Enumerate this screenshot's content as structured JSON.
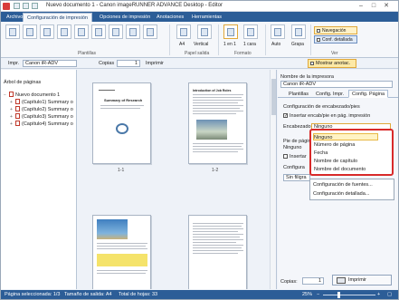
{
  "window": {
    "title": "Nuevo documento 1 - Canon imageRUNNER ADVANCE Desktop - Editor",
    "min_glyph": "–",
    "max_glyph": "□",
    "close_glyph": "✕"
  },
  "ribbon_tabs": [
    "Archivo",
    "Configuración de impresión",
    "Opciones de impresión",
    "Anotaciones",
    "Herramientas"
  ],
  "ribbon": {
    "groups": [
      "Plantillas",
      "Papel salida",
      "Formato",
      "Ver"
    ],
    "size_label": "A4",
    "orientation_label": "Vertical",
    "nup_label": "1 en 1",
    "copies_num": "1",
    "sides_label": "1 cara",
    "color_label": "Auto",
    "staple_label": "Grapa",
    "navigation": "Navegación",
    "detail": "Conf. detallada"
  },
  "toolbar": {
    "printer_label": "Impr.",
    "printer_value": "Canon iR-ADV",
    "copies_label": "Copias",
    "copies_value": "1",
    "print_label": "Imprimir",
    "show_notes": "Mostrar anotac."
  },
  "left_panel": {
    "title": "Árbol de páginas",
    "items": [
      {
        "label": "Nuevo documento 1",
        "expander": "−"
      },
      {
        "label": "(Capítulo1) Summary o",
        "expander": "+"
      },
      {
        "label": "(Capítulo2) Summary o",
        "expander": "+"
      },
      {
        "label": "(Capítulo3) Summary o",
        "expander": "+"
      },
      {
        "label": "(Capítulo4) Summary o",
        "expander": "+"
      }
    ]
  },
  "pages": [
    {
      "label": "1-1",
      "heading": "Summary of Research"
    },
    {
      "label": "1-2",
      "heading": "Introduction of Job Roles"
    },
    {
      "label": "",
      "heading": ""
    },
    {
      "label": "",
      "heading": ""
    }
  ],
  "right_panel": {
    "printer_name_label": "Nombre de la impresora",
    "printer_name_value": "Canon iR-ADV",
    "tabs": [
      "Plantillas",
      "Config. Impr.",
      "Config. Página"
    ],
    "section_title": "Configuración de encabezado/pies",
    "insert_header_label": "Insertar encab/pie en pág. impresión",
    "header_label": "Encabezado:",
    "header_value": "Ninguno",
    "footer_label": "Pie de págin",
    "footer_label2": "Ninguno",
    "insert_blank_label": "Insertar",
    "config_label": "Configura",
    "watermark_value": "Sin filigra",
    "dropdown_options": [
      "Ninguno",
      "Número de página",
      "Fecha",
      "Nombre de capítulo",
      "Nombre del documento"
    ],
    "submenu_items": [
      "Configuración de fuentes...",
      "Configuración detallada..."
    ],
    "copies_label": "Copias:",
    "copies_value": "1",
    "print_button": "Imprimir"
  },
  "status": {
    "pages_selected": "Página seleccionada: 1/3",
    "output_size": "Tamaño de salida: A4",
    "total_sheets": "Total de hojas: 33",
    "zoom": "25%"
  },
  "colors": {
    "ribbon_blue": "#2c5d97",
    "highlight_red": "#d82a2a",
    "selected_yellow": "#fff3c4"
  }
}
